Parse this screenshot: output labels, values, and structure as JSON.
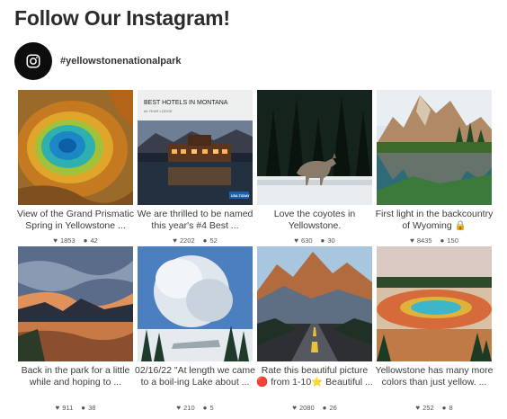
{
  "header": {
    "title": "Follow Our Instagram!"
  },
  "profile": {
    "handle": "#yellowstonenationalpark",
    "icon": "instagram-icon"
  },
  "posts": [
    {
      "caption": "View of the Grand Prismatic Spring in Yellowstone ...",
      "likes": "1853",
      "comments": "42"
    },
    {
      "caption": "We are thrilled to be named this year's #4 Best ...",
      "likes": "2202",
      "comments": "52",
      "image_text": {
        "line1": "BEST HOTELS IN MONTANA",
        "line2": "#4 YEAR LODGE",
        "logo": "USA TODAY"
      }
    },
    {
      "caption": "Love the coyotes in Yellowstone.",
      "likes": "630",
      "comments": "30"
    },
    {
      "caption": "First light in the backcountry of Wyoming 🔒",
      "likes": "8435",
      "comments": "150"
    },
    {
      "caption": "Back in the park for a little while and hoping to ...",
      "likes": "911",
      "comments": "38"
    },
    {
      "caption": "02/16/22 \"At length we came to a boil-ing Lake about ...",
      "likes": "210",
      "comments": "5"
    },
    {
      "caption": "Rate this beautiful picture 🔴 from 1-10⭐ Beautiful ...",
      "likes": "2080",
      "comments": "26"
    },
    {
      "caption": "Yellowstone has many more colors than just yellow. ...",
      "likes": "252",
      "comments": "8"
    }
  ],
  "icons": {
    "likes": "heart-icon",
    "comments": "comment-icon"
  }
}
